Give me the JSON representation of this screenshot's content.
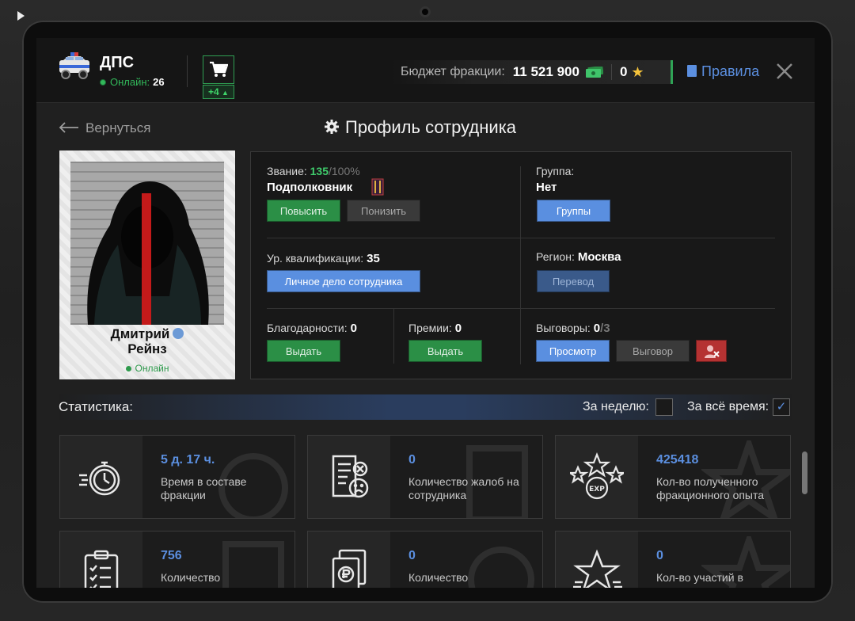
{
  "header": {
    "faction_name": "ДПС",
    "online_label": "Онлайн:",
    "online_count": "26",
    "cart_badge": "+4",
    "budget_label": "Бюджет фракции:",
    "budget_value": "11 521 900",
    "stars_value": "0",
    "rules_label": "Правила"
  },
  "nav": {
    "back_label": "Вернуться",
    "page_title": "Профиль сотрудника"
  },
  "profile": {
    "first_name": "Дмитрий",
    "last_name": "Рейнз",
    "status": "Онлайн"
  },
  "info": {
    "rank_label": "Звание:",
    "rank_progress": "135",
    "rank_progress_max": "/100%",
    "rank_name": "Подполковник",
    "promote_label": "Повысить",
    "demote_label": "Понизить",
    "group_label": "Группа:",
    "group_value": "Нет",
    "groups_button": "Группы",
    "qual_label": "Ур. квалификации:",
    "qual_value": "35",
    "dossier_button": "Личное дело сотрудника",
    "region_label": "Регион:",
    "region_value": "Москва",
    "transfer_button": "Перевод",
    "thanks_label": "Благодарности:",
    "thanks_value": "0",
    "thanks_button": "Выдать",
    "bonus_label": "Премии:",
    "bonus_value": "0",
    "bonus_button": "Выдать",
    "reprimand_label": "Выговоры:",
    "reprimand_value": "0",
    "reprimand_max": "/3",
    "view_button": "Просмотр",
    "reprimand_button": "Выговор"
  },
  "stats": {
    "title": "Статистика:",
    "week_label": "За неделю:",
    "all_time_label": "За всё время:",
    "cards": [
      {
        "value": "5 д. 17 ч.",
        "label": "Время в составе фракции",
        "icon": "stopwatch-icon"
      },
      {
        "value": "0",
        "label": "Количество жалоб на сотрудника",
        "icon": "complaint-document-icon"
      },
      {
        "value": "425418",
        "label": "Кол-во полученного фракционного опыта",
        "icon": "exp-stars-icon"
      },
      {
        "value": "756",
        "label": "Количество",
        "icon": "clipboard-checklist-icon"
      },
      {
        "value": "0",
        "label": "Количество",
        "icon": "ruble-documents-icon"
      },
      {
        "value": "0",
        "label": "Кол-во участий в",
        "icon": "star-icon"
      }
    ]
  }
}
